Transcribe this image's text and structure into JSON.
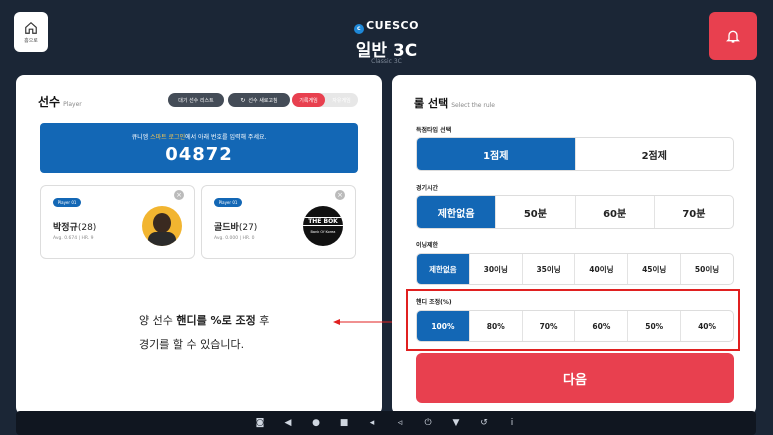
{
  "header": {
    "home_label": "홈으로",
    "brand": "CUESCO",
    "title": "일반 3C",
    "subtitle": "Classic 3C"
  },
  "players": {
    "title": "선수",
    "title_en": "Player",
    "wait_list_label": "대기 선수 리스트",
    "refresh_label": "선수 새로고침",
    "mode_on_label": "기록게임",
    "mode_off_label": "자유게임",
    "hint_prefix": "큐니엠 ",
    "hint_highlight": "스마트 로그인",
    "hint_suffix": "에서 아래 번호를 입력해 주세요.",
    "code": "04872",
    "cards": [
      {
        "badge": "Player 01",
        "name": "박정규",
        "age": "(28)",
        "stats": "Avg. 0.674  |  HR. 9"
      },
      {
        "badge": "Player 01",
        "name": "골드바",
        "age": "(27)",
        "stats": "Avg. 0.000  |  HR. 0",
        "avatar_logo_top": "THE BOK",
        "avatar_logo_bot": "Bank Of Korea"
      }
    ]
  },
  "annotation": {
    "line1_a": "양 선수 ",
    "line1_b": "핸디를 %로 조정",
    "line1_c": " 후",
    "line2": "경기를 할 수 있습니다."
  },
  "rules": {
    "title": "룰 선택",
    "title_en": "Select the rule",
    "scoring": {
      "label": "득점타입 선택",
      "options": [
        "1점제",
        "2점제"
      ],
      "selected": 0
    },
    "time": {
      "label": "경기시간",
      "options": [
        "제한없음",
        "50분",
        "60분",
        "70분"
      ],
      "selected": 0
    },
    "inning": {
      "label": "이닝제한",
      "options": [
        "제한없음",
        "30이닝",
        "35이닝",
        "40이닝",
        "45이닝",
        "50이닝"
      ],
      "selected": 0
    },
    "handicap": {
      "label": "핸디 조정(%)",
      "options": [
        "100%",
        "80%",
        "70%",
        "60%",
        "50%",
        "40%"
      ],
      "selected": 0
    },
    "next_label": "다음"
  },
  "colors": {
    "accent": "#1367b5",
    "danger": "#e8404f",
    "background": "#1b2636"
  },
  "navbar_icons": [
    "camera-icon",
    "back-icon",
    "home-icon",
    "recents-icon",
    "volume-down-icon",
    "volume-up-icon",
    "power-icon",
    "menu-down-icon",
    "rotate-icon",
    "info-icon"
  ]
}
